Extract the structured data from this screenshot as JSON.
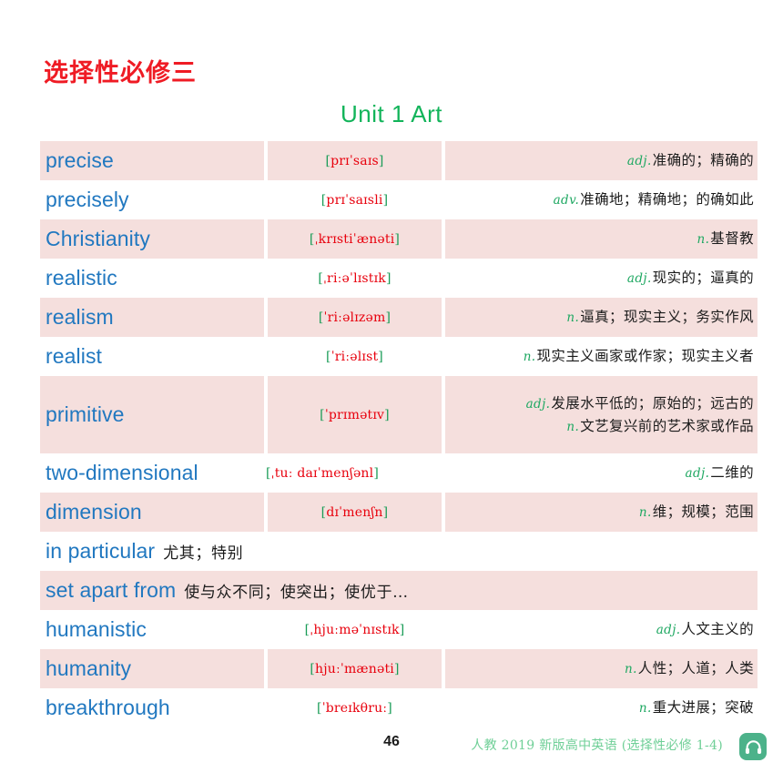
{
  "book_title": "选择性必修三",
  "unit_title": "Unit 1 Art",
  "entries": [
    {
      "kind": "word",
      "shade": "shade",
      "height": "h1",
      "word": "precise",
      "phonetic": "prɪˈsaɪs",
      "defs": [
        {
          "pos": "adj.",
          "cn": "准确的；精确的"
        }
      ]
    },
    {
      "kind": "word",
      "shade": "plain",
      "height": "h1",
      "word": "precisely",
      "phonetic": "prɪˈsaɪsli",
      "defs": [
        {
          "pos": "adv.",
          "cn": "准确地；精确地；的确如此"
        }
      ]
    },
    {
      "kind": "word",
      "shade": "shade",
      "height": "h1",
      "word": "Christianity",
      "phonetic": "ˌkrɪstiˈænəti",
      "defs": [
        {
          "pos": "n.",
          "cn": "基督教"
        }
      ]
    },
    {
      "kind": "word",
      "shade": "plain",
      "height": "h1",
      "word": "realistic",
      "phonetic": "ˌriːəˈlɪstɪk",
      "defs": [
        {
          "pos": "adj.",
          "cn": "现实的；逼真的"
        }
      ]
    },
    {
      "kind": "word",
      "shade": "shade",
      "height": "h1",
      "word": "realism",
      "phonetic": "ˈriːəlɪzəm",
      "defs": [
        {
          "pos": "n.",
          "cn": "逼真；现实主义；务实作风"
        }
      ]
    },
    {
      "kind": "word",
      "shade": "plain",
      "height": "h1",
      "word": "realist",
      "phonetic": "ˈriːəlɪst",
      "defs": [
        {
          "pos": "n.",
          "cn": "现实主义画家或作家；现实主义者"
        }
      ]
    },
    {
      "kind": "word",
      "shade": "shade",
      "height": "h2",
      "word": "primitive",
      "phonetic": "ˈprɪmətɪv",
      "defs": [
        {
          "pos": "adj.",
          "cn": "发展水平低的；原始的；远古的"
        },
        {
          "pos": "n.",
          "cn": "文艺复兴前的艺术家或作品"
        }
      ]
    },
    {
      "kind": "word",
      "shade": "plain",
      "height": "h1",
      "wide": true,
      "word": "two-dimensional",
      "phonetic": "ˌtuː daɪˈmenʃənl",
      "defs": [
        {
          "pos": "adj.",
          "cn": "二维的"
        }
      ]
    },
    {
      "kind": "word",
      "shade": "shade",
      "height": "h1",
      "word": "dimension",
      "phonetic": "dɪˈmenʃn",
      "defs": [
        {
          "pos": "n.",
          "cn": "维；规模；范围"
        }
      ]
    },
    {
      "kind": "phrase",
      "shade": "plain",
      "word": "in particular",
      "cn": "尤其；特别"
    },
    {
      "kind": "phrase",
      "shade": "shade",
      "word": "set apart from",
      "cn": "使与众不同；使突出；使优于…"
    },
    {
      "kind": "word",
      "shade": "plain",
      "height": "h1",
      "word": "humanistic",
      "phonetic": "ˌhjuːməˈnɪstɪk",
      "defs": [
        {
          "pos": "adj.",
          "cn": "人文主义的"
        }
      ]
    },
    {
      "kind": "word",
      "shade": "shade",
      "height": "h1",
      "word": "humanity",
      "phonetic": "hjuːˈmænəti",
      "defs": [
        {
          "pos": "n.",
          "cn": "人性；人道；人类"
        }
      ]
    },
    {
      "kind": "word",
      "shade": "plain",
      "height": "h1",
      "word": "breakthrough",
      "phonetic": "ˈbreɪkθruː",
      "defs": [
        {
          "pos": "n.",
          "cn": "重大进展；突破"
        }
      ]
    }
  ],
  "footer": {
    "page_number": "46",
    "note": "人教 2019 新版高中英语 (选择性必修 1-4)",
    "audio_icon": "headphone-icon"
  },
  "colors": {
    "book_title_red": "#ef1b24",
    "unit_green": "#12b45a",
    "word_blue": "#2178c0",
    "phonetic_red": "#e8000d",
    "bracket_green": "#1a9c57",
    "pos_green": "#1fa862",
    "row_shade": "#f5dfdd",
    "footer_green": "#6fcf97",
    "badge_green": "#4cb28a"
  }
}
